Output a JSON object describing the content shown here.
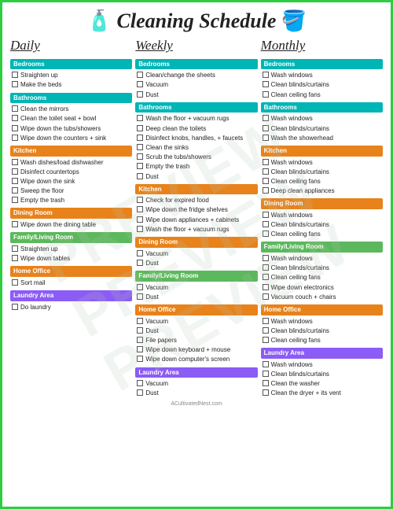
{
  "header": {
    "title": "Cleaning Schedule",
    "footer": "ACultivatedNest.com"
  },
  "watermark": "PREVIEW",
  "columns": [
    {
      "title": "Daily",
      "sections": [
        {
          "name": "Bedrooms",
          "color": "bg-teal",
          "items": [
            "Straighten up",
            "Make the beds"
          ]
        },
        {
          "name": "Bathrooms",
          "color": "bg-teal",
          "items": [
            "Clean the mirrors",
            "Clean the toilet seat + bowl",
            "Wipe down the tubs/showers",
            "Wipe down the counters + sink"
          ]
        },
        {
          "name": "Kitchen",
          "color": "bg-orange",
          "items": [
            "Wash dishes/load dishwasher",
            "Disinfect countertops",
            "Wipe down the sink",
            "Sweep the floor",
            "Empty the trash"
          ]
        },
        {
          "name": "Dining Room",
          "color": "bg-orange",
          "items": [
            "Wipe down the dining table"
          ]
        },
        {
          "name": "Family/Living Room",
          "color": "bg-green",
          "items": [
            "Straighten up",
            "Wipe down tables"
          ]
        },
        {
          "name": "Home Office",
          "color": "bg-orange",
          "items": [
            "Sort mail"
          ]
        },
        {
          "name": "Laundry Area",
          "color": "bg-purple",
          "items": [
            "Do laundry"
          ]
        }
      ]
    },
    {
      "title": "Weekly",
      "sections": [
        {
          "name": "Bedrooms",
          "color": "bg-teal",
          "items": [
            "Clean/change the sheets",
            "Vacuum",
            "Dust"
          ]
        },
        {
          "name": "Bathrooms",
          "color": "bg-teal",
          "items": [
            "Wash the floor + vacuum rugs",
            "Deep clean the toilets",
            "Disinfect knobs, handles, + faucets",
            "Clean the sinks",
            "Scrub the tubs/showers",
            "Empty the trash",
            "Dust"
          ]
        },
        {
          "name": "Kitchen",
          "color": "bg-orange",
          "items": [
            "Check for expired food",
            "Wipe down the fridge shelves",
            "Wipe down appliances + cabinets",
            "Wash the floor + vacuum rugs"
          ]
        },
        {
          "name": "Dining Room",
          "color": "bg-orange",
          "items": [
            "Vacuum",
            "Dust"
          ]
        },
        {
          "name": "Family/Living Room",
          "color": "bg-green",
          "items": [
            "Vacuum",
            "Dust"
          ]
        },
        {
          "name": "Home Office",
          "color": "bg-orange",
          "items": [
            "Vacuum",
            "Dust",
            "File papers",
            "Wipe down keyboard + mouse",
            "Wipe down computer's screen"
          ]
        },
        {
          "name": "Laundry Area",
          "color": "bg-purple",
          "items": [
            "Vacuum",
            "Dust"
          ]
        }
      ]
    },
    {
      "title": "Monthly",
      "sections": [
        {
          "name": "Bedrooms",
          "color": "bg-teal",
          "items": [
            "Wash windows",
            "Clean blinds/curtains",
            "Clean ceiling fans"
          ]
        },
        {
          "name": "Bathrooms",
          "color": "bg-teal",
          "items": [
            "Wash windows",
            "Clean blinds/curtains",
            "Wash the showerhead"
          ]
        },
        {
          "name": "Kitchen",
          "color": "bg-orange",
          "items": [
            "Wash windows",
            "Clean blinds/curtains",
            "Clean ceiling fans",
            "Deep clean appliances"
          ]
        },
        {
          "name": "Dining Room",
          "color": "bg-orange",
          "items": [
            "Wash windows",
            "Clean blinds/curtains",
            "Clean ceiling fans"
          ]
        },
        {
          "name": "Family/Living Room",
          "color": "bg-green",
          "items": [
            "Wash windows",
            "Clean blinds/curtains",
            "Clean ceiling fans",
            "Wipe down electronics",
            "Vacuum couch + chairs"
          ]
        },
        {
          "name": "Home Office",
          "color": "bg-orange",
          "items": [
            "Wash windows",
            "Clean blinds/curtains",
            "Clean ceiling fans"
          ]
        },
        {
          "name": "Laundry Area",
          "color": "bg-purple",
          "items": [
            "Wash windows",
            "Clean blinds/curtains",
            "Clean the washer",
            "Clean the dryer + its vent"
          ]
        }
      ]
    }
  ]
}
